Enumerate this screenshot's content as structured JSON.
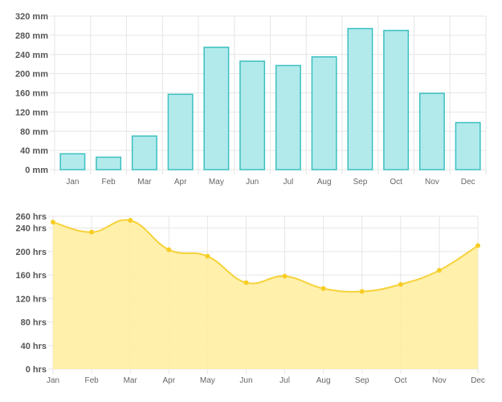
{
  "charts": {
    "colors": {
      "bar_fill": "#b2eaeb",
      "bar_stroke": "#3cbfc0",
      "area_fill": "#ffeea3",
      "line": "#f7d23a",
      "point": "#f7cc1f",
      "grid": "#e6e6e6"
    }
  },
  "chart_data": [
    {
      "type": "bar",
      "categories": [
        "Jan",
        "Feb",
        "Mar",
        "Apr",
        "May",
        "Jun",
        "Jul",
        "Aug",
        "Sep",
        "Oct",
        "Nov",
        "Dec"
      ],
      "values": [
        33,
        26,
        70,
        157,
        255,
        226,
        217,
        235,
        294,
        290,
        159,
        98
      ],
      "ylim": [
        0,
        320
      ],
      "yticks": [
        0,
        40,
        80,
        120,
        160,
        200,
        240,
        280,
        320
      ],
      "yticklabels": [
        "0 mm",
        "40 mm",
        "80 mm",
        "120 mm",
        "160 mm",
        "200 mm",
        "240 mm",
        "280 mm",
        "320 mm"
      ],
      "grid": true,
      "legend": "none"
    },
    {
      "type": "area",
      "categories": [
        "Jan",
        "Feb",
        "Mar",
        "Apr",
        "May",
        "Jun",
        "Jul",
        "Aug",
        "Sep",
        "Oct",
        "Nov",
        "Dec"
      ],
      "values": [
        250,
        233,
        253,
        203,
        192,
        147,
        158,
        137,
        132,
        144,
        168,
        210
      ],
      "ylim": [
        0,
        260
      ],
      "yticks": [
        0,
        40,
        80,
        120,
        160,
        200,
        240,
        260
      ],
      "yticklabels": [
        "0 hrs",
        "40 hrs",
        "80 hrs",
        "120 hrs",
        "160 hrs",
        "200 hrs",
        "240 hrs",
        "260 hrs"
      ],
      "grid": true,
      "legend": "none",
      "smooth": true
    }
  ]
}
